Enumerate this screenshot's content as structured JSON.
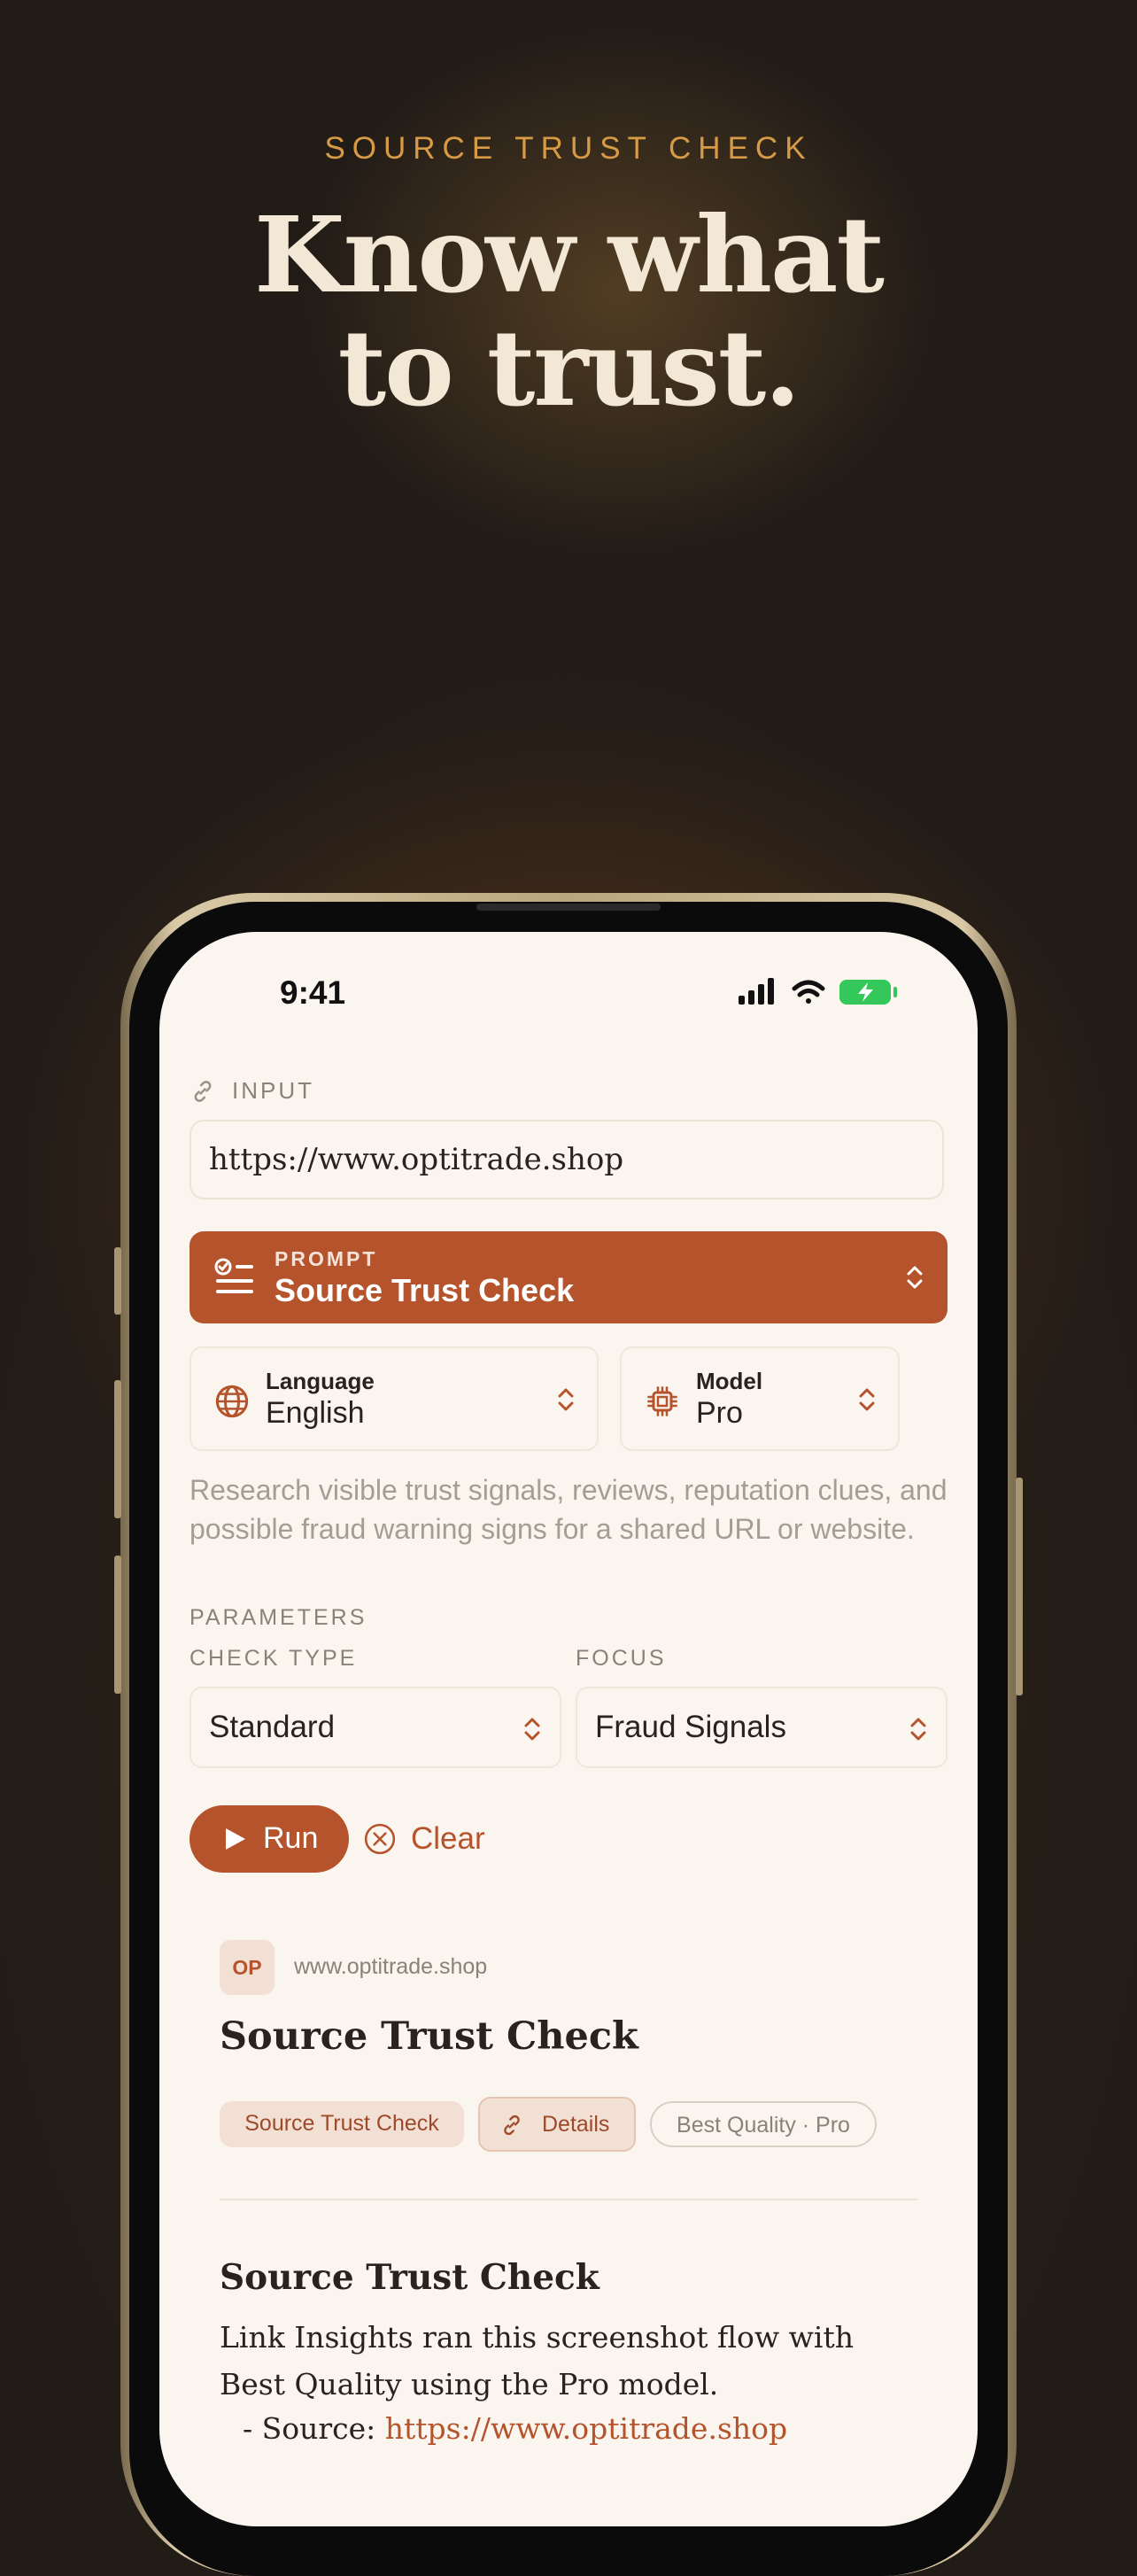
{
  "hero": {
    "eyebrow": "SOURCE TRUST CHECK",
    "headline_line1": "Know what",
    "headline_line2": "to trust."
  },
  "status_bar": {
    "time": "9:41"
  },
  "input": {
    "label": "INPUT",
    "url_value": "https://www.optitrade.shop"
  },
  "prompt": {
    "small_label": "PROMPT",
    "title": "Source Trust Check"
  },
  "language": {
    "label": "Language",
    "value": "English"
  },
  "model": {
    "label": "Model",
    "value": "Pro"
  },
  "description": "Research visible trust signals, reviews, reputation clues, and possible fraud warning signs for a shared URL or website.",
  "parameters": {
    "label": "PARAMETERS",
    "check_type_label": "CHECK TYPE",
    "check_type_value": "Standard",
    "focus_label": "FOCUS",
    "focus_value": "Fraud Signals"
  },
  "actions": {
    "run": "Run",
    "clear": "Clear"
  },
  "result": {
    "avatar_initials": "OP",
    "domain": "www.optitrade.shop",
    "title": "Source Trust Check",
    "chips": {
      "prompt": "Source Trust Check",
      "details": "Details",
      "quality": "Best Quality · Pro"
    },
    "section_title": "Source Trust Check",
    "body": "Link Insights ran this screenshot flow with Best Quality using the Pro model.",
    "source_prefix": "- Source:",
    "source_link": "https://www.optitrade.shop"
  },
  "colors": {
    "accent": "#b5532c",
    "gold": "#d79a45",
    "background": "#221c17",
    "screen": "#faf6ef"
  }
}
